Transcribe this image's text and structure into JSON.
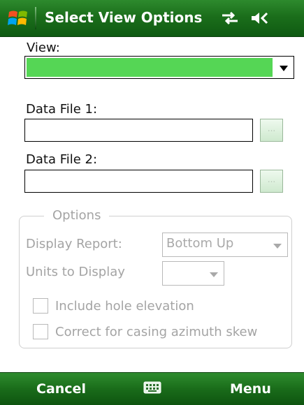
{
  "titlebar": {
    "title": "Select View Options",
    "icons": [
      "windows-start-icon",
      "connectivity-icon",
      "speaker-muted-icon"
    ]
  },
  "form": {
    "view_label": "View:",
    "view_value": "",
    "view_fill_color": "#55d655",
    "data_file_1_label": "Data File 1:",
    "data_file_1_value": "",
    "data_file_2_label": "Data File 2:",
    "data_file_2_value": "",
    "browse_label": "..."
  },
  "options": {
    "legend": "Options",
    "display_report_label": "Display Report:",
    "display_report_value": "Bottom Up",
    "units_label": "Units to Display",
    "units_value": "",
    "include_hole_elevation": {
      "label": "Include hole elevation",
      "checked": false
    },
    "correct_casing_skew": {
      "label": "Correct for casing azimuth skew",
      "checked": false
    }
  },
  "softkeys": {
    "left": "Cancel",
    "right": "Menu",
    "center_icon": "keyboard-icon"
  },
  "colors": {
    "bar_green": "#1b6e1b",
    "disabled_text": "#a4a4a4"
  }
}
